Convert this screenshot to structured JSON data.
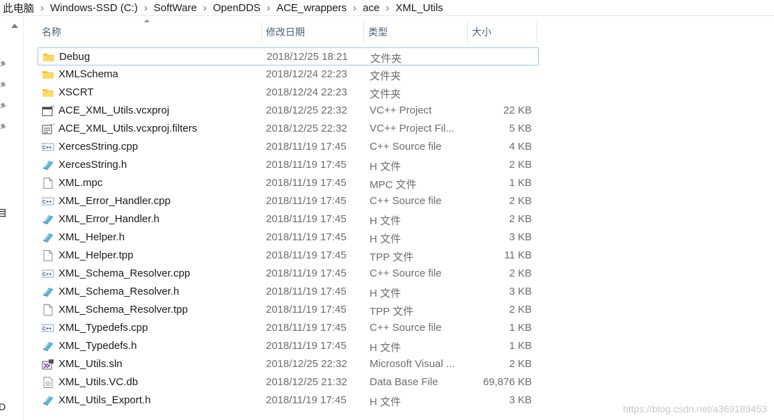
{
  "breadcrumb": [
    "此电脑",
    "Windows-SSD (C:)",
    "SoftWare",
    "OpenDDS",
    "ACE_wrappers",
    "ace",
    "XML_Utils"
  ],
  "nav_fragments": [
    "目",
    "D"
  ],
  "columns": {
    "name": "名称",
    "date": "修改日期",
    "type": "类型",
    "size": "大小"
  },
  "files": [
    {
      "name": "Debug",
      "date": "2018/12/25 18:21",
      "type": "文件夹",
      "size": "",
      "icon": "folder-icon"
    },
    {
      "name": "XMLSchema",
      "date": "2018/12/24 22:23",
      "type": "文件夹",
      "size": "",
      "icon": "folder-icon"
    },
    {
      "name": "XSCRT",
      "date": "2018/12/24 22:23",
      "type": "文件夹",
      "size": "",
      "icon": "folder-icon"
    },
    {
      "name": "ACE_XML_Utils.vcxproj",
      "date": "2018/12/25 22:32",
      "type": "VC++ Project",
      "size": "22 KB",
      "icon": "vcxproj-icon"
    },
    {
      "name": "ACE_XML_Utils.vcxproj.filters",
      "date": "2018/12/25 22:32",
      "type": "VC++ Project Fil...",
      "size": "5 KB",
      "icon": "vcxproj-filters-icon"
    },
    {
      "name": "XercesString.cpp",
      "date": "2018/11/19 17:45",
      "type": "C++ Source file",
      "size": "4 KB",
      "icon": "cpp-file-icon"
    },
    {
      "name": "XercesString.h",
      "date": "2018/11/19 17:45",
      "type": "H 文件",
      "size": "2 KB",
      "icon": "header-file-icon"
    },
    {
      "name": "XML.mpc",
      "date": "2018/11/19 17:45",
      "type": "MPC 文件",
      "size": "1 KB",
      "icon": "blank-file-icon"
    },
    {
      "name": "XML_Error_Handler.cpp",
      "date": "2018/11/19 17:45",
      "type": "C++ Source file",
      "size": "2 KB",
      "icon": "cpp-file-icon"
    },
    {
      "name": "XML_Error_Handler.h",
      "date": "2018/11/19 17:45",
      "type": "H 文件",
      "size": "2 KB",
      "icon": "header-file-icon"
    },
    {
      "name": "XML_Helper.h",
      "date": "2018/11/19 17:45",
      "type": "H 文件",
      "size": "3 KB",
      "icon": "header-file-icon"
    },
    {
      "name": "XML_Helper.tpp",
      "date": "2018/11/19 17:45",
      "type": "TPP 文件",
      "size": "11 KB",
      "icon": "blank-file-icon"
    },
    {
      "name": "XML_Schema_Resolver.cpp",
      "date": "2018/11/19 17:45",
      "type": "C++ Source file",
      "size": "2 KB",
      "icon": "cpp-file-icon"
    },
    {
      "name": "XML_Schema_Resolver.h",
      "date": "2018/11/19 17:45",
      "type": "H 文件",
      "size": "3 KB",
      "icon": "header-file-icon"
    },
    {
      "name": "XML_Schema_Resolver.tpp",
      "date": "2018/11/19 17:45",
      "type": "TPP 文件",
      "size": "2 KB",
      "icon": "blank-file-icon"
    },
    {
      "name": "XML_Typedefs.cpp",
      "date": "2018/11/19 17:45",
      "type": "C++ Source file",
      "size": "1 KB",
      "icon": "cpp-file-icon"
    },
    {
      "name": "XML_Typedefs.h",
      "date": "2018/11/19 17:45",
      "type": "H 文件",
      "size": "1 KB",
      "icon": "header-file-icon"
    },
    {
      "name": "XML_Utils.sln",
      "date": "2018/12/25 22:32",
      "type": "Microsoft Visual ...",
      "size": "2 KB",
      "icon": "sln-file-icon"
    },
    {
      "name": "XML_Utils.VC.db",
      "date": "2018/12/25 21:32",
      "type": "Data Base File",
      "size": "69,876 KB",
      "icon": "db-file-icon"
    },
    {
      "name": "XML_Utils_Export.h",
      "date": "2018/11/19 17:45",
      "type": "H 文件",
      "size": "3 KB",
      "icon": "header-file-icon"
    }
  ],
  "selected_index": 0,
  "watermark": "https://blog.csdn.net/a369189453",
  "colors": {
    "accent": "#99c9ef",
    "folder": "#f5c342",
    "header_text": "#4c607a"
  }
}
